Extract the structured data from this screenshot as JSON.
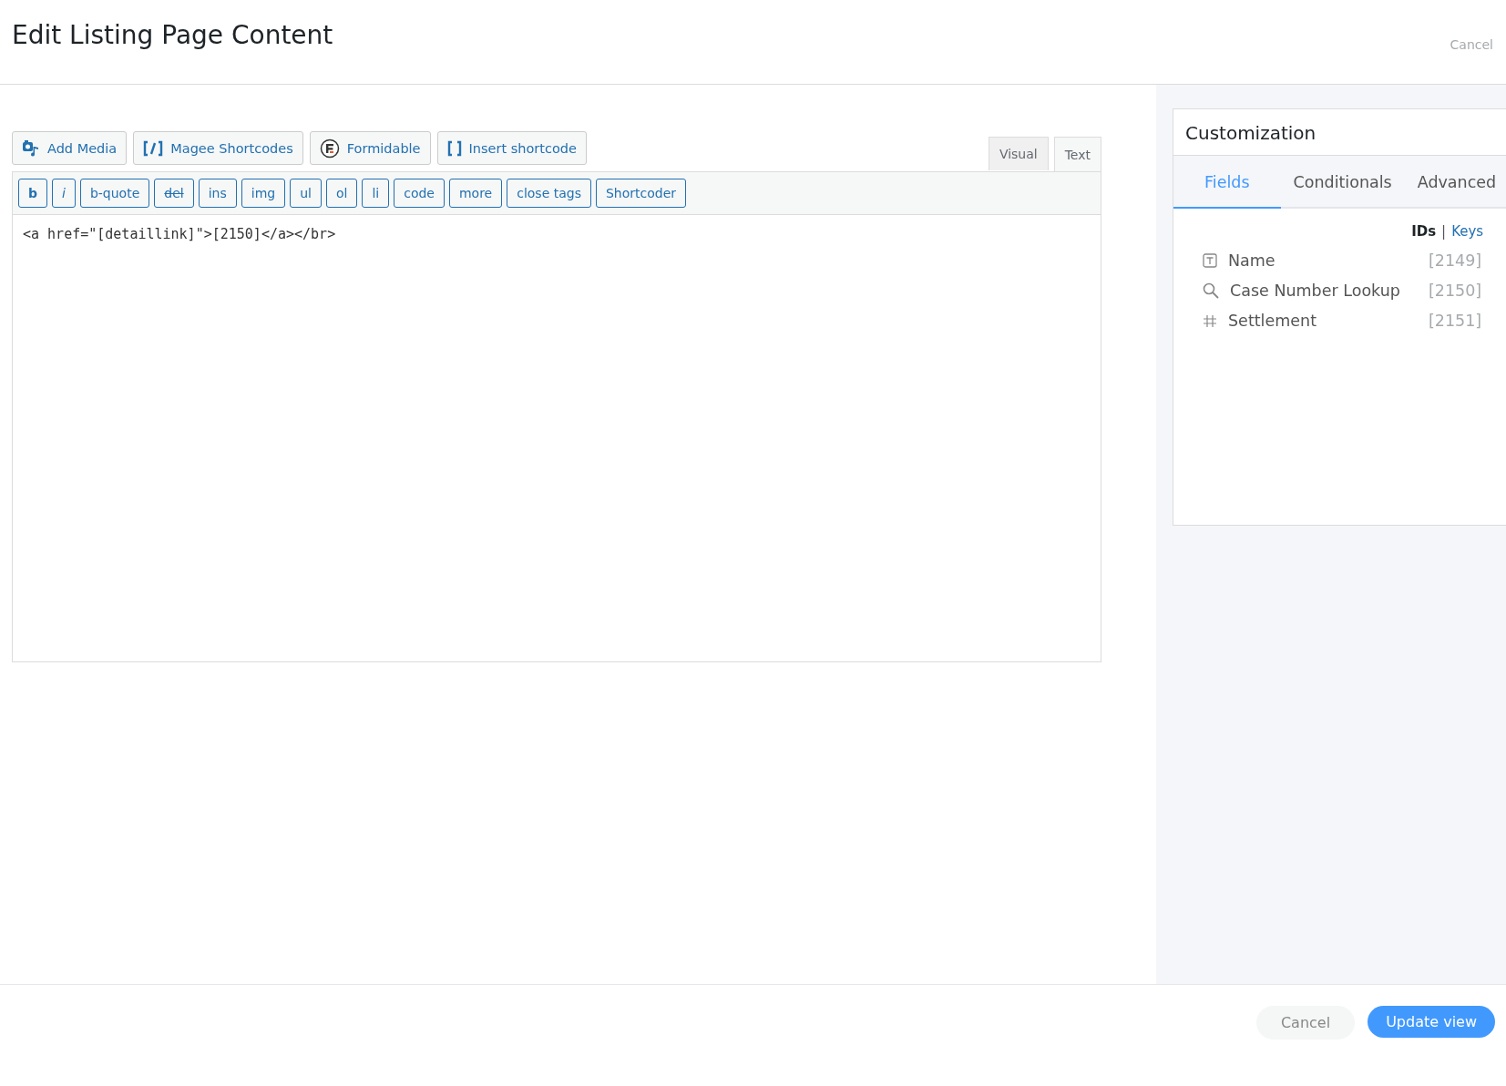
{
  "header": {
    "title": "Edit Listing Page Content",
    "cancel": "Cancel"
  },
  "media_buttons": [
    {
      "label": "Add Media",
      "kind": "media"
    },
    {
      "label": "Magee Shortcodes",
      "kind": "shortcodes"
    },
    {
      "label": "Formidable",
      "kind": "formidable"
    },
    {
      "label": "Insert shortcode",
      "kind": "brackets"
    }
  ],
  "editor_tabs": [
    {
      "label": "Visual",
      "selected": false
    },
    {
      "label": "Text",
      "selected": true
    }
  ],
  "quicktags": [
    {
      "label": "b",
      "kind": "bold"
    },
    {
      "label": "i",
      "kind": "italic"
    },
    {
      "label": "b-quote",
      "kind": "plain"
    },
    {
      "label": "del",
      "kind": "strike"
    },
    {
      "label": "ins",
      "kind": "plain"
    },
    {
      "label": "img",
      "kind": "plain"
    },
    {
      "label": "ul",
      "kind": "plain"
    },
    {
      "label": "ol",
      "kind": "plain"
    },
    {
      "label": "li",
      "kind": "plain"
    },
    {
      "label": "code",
      "kind": "plain"
    },
    {
      "label": "more",
      "kind": "plain"
    },
    {
      "label": "close tags",
      "kind": "plain"
    },
    {
      "label": "Shortcoder",
      "kind": "plain"
    }
  ],
  "editor_content": "<a href=\"[detaillink]\">[2150]</a></br>",
  "customization": {
    "title": "Customization",
    "tabs": [
      {
        "label": "Fields",
        "selected": true
      },
      {
        "label": "Conditionals",
        "selected": false
      },
      {
        "label": "Advanced",
        "selected": false
      }
    ],
    "id_modes": [
      {
        "label": "IDs",
        "selected": true
      },
      {
        "label": "Keys",
        "selected": false
      }
    ],
    "separator": "|",
    "fields": [
      {
        "name": "Name",
        "id": "[2149]",
        "kind": "text"
      },
      {
        "name": "Case Number Lookup",
        "id": "[2150]",
        "kind": "lookup"
      },
      {
        "name": "Settlement",
        "id": "[2151]",
        "kind": "number"
      }
    ]
  },
  "footer": {
    "cancel": "Cancel",
    "submit": "Update view"
  }
}
